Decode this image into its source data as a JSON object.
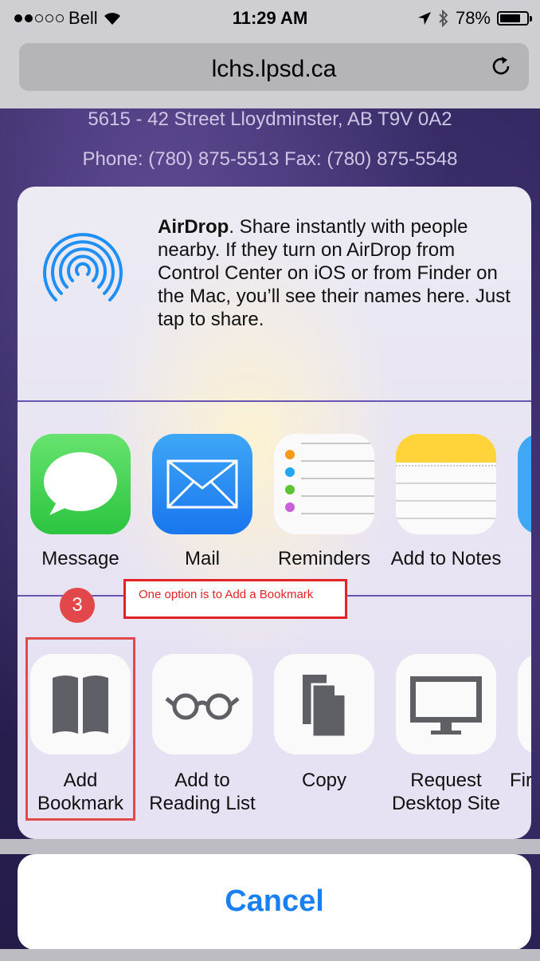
{
  "status_bar": {
    "carrier": "Bell",
    "time": "11:29 AM",
    "battery": "78%",
    "battery_level": 0.78,
    "signal_bars_filled": 2,
    "signal_bars_total": 5
  },
  "browser": {
    "url": "lchs.lpsd.ca",
    "reload_icon": "reload-icon"
  },
  "page": {
    "address_line": "5615 - 42 Street Lloydminster, AB T9V 0A2",
    "phone_line": "Phone: (780) 875-5513 Fax: (780) 875-5548"
  },
  "share_sheet": {
    "airdrop": {
      "title": "AirDrop",
      "description": ". Share instantly with people nearby. If they turn on AirDrop from Control Center on iOS or from Finder on the Mac, you’ll see their names here. Just tap to share."
    },
    "apps": [
      {
        "label": "Message",
        "icon": "message-icon"
      },
      {
        "label": "Mail",
        "icon": "mail-icon"
      },
      {
        "label": "Reminders",
        "icon": "reminders-icon"
      },
      {
        "label": "Add to Notes",
        "icon": "notes-icon"
      }
    ],
    "actions": [
      {
        "line1": "Add",
        "line2": "Bookmark",
        "icon": "bookmark-icon"
      },
      {
        "line1": "Add to",
        "line2": "Reading List",
        "icon": "glasses-icon"
      },
      {
        "line1": "Copy",
        "line2": "",
        "icon": "copy-icon"
      },
      {
        "line1": "Request",
        "line2": "Desktop Site",
        "icon": "desktop-icon"
      },
      {
        "line1": "Fir",
        "line2": "",
        "icon": "find-icon"
      }
    ],
    "cancel_label": "Cancel"
  },
  "annotation": {
    "callout_text": "One option is to Add a Bookmark",
    "step_number": "3",
    "color": "#e22226"
  },
  "colors": {
    "accent": "#1a7ff2",
    "separator": "#6a55b2"
  }
}
